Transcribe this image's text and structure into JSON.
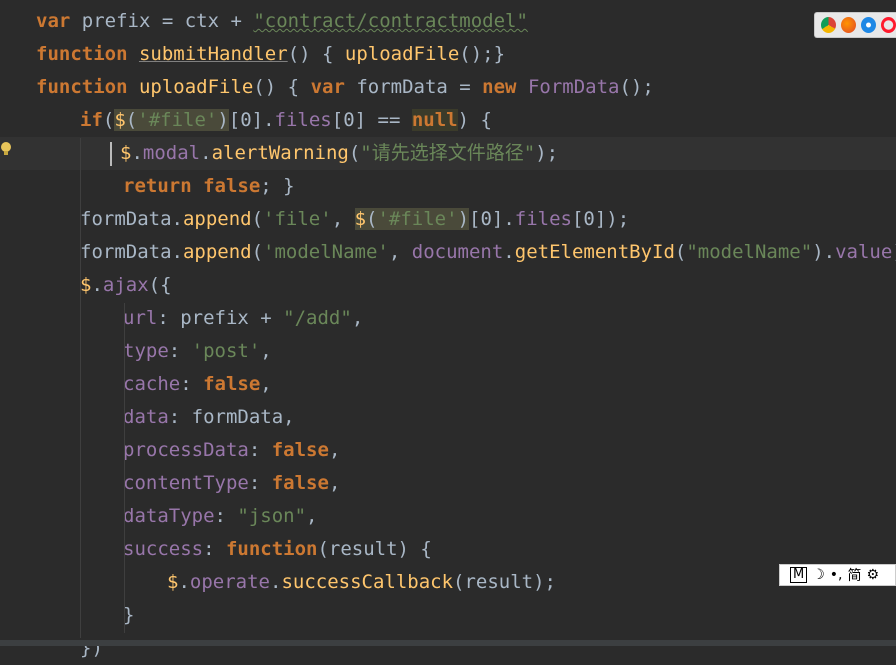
{
  "editor": {
    "lines": [
      {
        "tokens": [
          [
            "kw",
            "var"
          ],
          [
            "pl",
            " prefix = ctx + "
          ],
          [
            "str uw",
            "\"contract/contractmodel\""
          ]
        ]
      },
      {
        "tokens": [
          [
            "kw",
            "function"
          ],
          [
            "pl",
            " "
          ],
          [
            "fn ugray",
            "submitHandler"
          ],
          [
            "pl",
            "() { "
          ],
          [
            "fn",
            "uploadFile"
          ],
          [
            "pl",
            "();}"
          ]
        ]
      },
      {
        "tokens": [
          [
            "kw",
            "function"
          ],
          [
            "pl",
            " "
          ],
          [
            "fn",
            "uploadFile"
          ],
          [
            "pl",
            "() { "
          ],
          [
            "kw",
            "var"
          ],
          [
            "pl",
            " formData = "
          ],
          [
            "kw",
            "new"
          ],
          [
            "pl",
            " "
          ],
          [
            "prop",
            "FormData"
          ],
          [
            "pl",
            "();"
          ]
        ]
      },
      {
        "tokens": [
          [
            "kw",
            "if"
          ],
          [
            "pl",
            "("
          ],
          [
            "fn hl",
            "$"
          ],
          [
            "pl hl",
            "("
          ],
          [
            "str hl",
            "'#file'"
          ],
          [
            "pl hl",
            ")"
          ],
          [
            "pl",
            "[0]."
          ],
          [
            "prop",
            "files"
          ],
          [
            "pl",
            "[0] == "
          ],
          [
            "kw hl2",
            "null"
          ],
          [
            "pl",
            ") {"
          ]
        ]
      },
      {
        "tokens": [
          [
            "fn",
            "$"
          ],
          [
            "pl",
            "."
          ],
          [
            "prop",
            "modal"
          ],
          [
            "pl",
            "."
          ],
          [
            "fn",
            "alertWarning"
          ],
          [
            "pl",
            "("
          ],
          [
            "str",
            "\"请先选择文件路径\""
          ],
          [
            "pl",
            ");"
          ]
        ]
      },
      {
        "tokens": [
          [
            "kw",
            "return false"
          ],
          [
            "pl",
            "; }"
          ]
        ]
      },
      {
        "tokens": [
          [
            "pl",
            "formData."
          ],
          [
            "fn",
            "append"
          ],
          [
            "pl",
            "("
          ],
          [
            "str",
            "'file'"
          ],
          [
            "pl",
            ", "
          ],
          [
            "fn hl",
            "$"
          ],
          [
            "pl hl",
            "("
          ],
          [
            "str hl",
            "'#file'"
          ],
          [
            "pl hl",
            ")"
          ],
          [
            "pl",
            "[0]."
          ],
          [
            "prop",
            "files"
          ],
          [
            "pl",
            "[0]);"
          ]
        ]
      },
      {
        "tokens": [
          [
            "pl",
            "formData."
          ],
          [
            "fn",
            "append"
          ],
          [
            "pl",
            "("
          ],
          [
            "str",
            "'modelName'"
          ],
          [
            "pl",
            ", "
          ],
          [
            "prop",
            "document"
          ],
          [
            "pl",
            "."
          ],
          [
            "fn",
            "getElementById"
          ],
          [
            "pl",
            "("
          ],
          [
            "str",
            "\"modelName\""
          ],
          [
            "pl",
            ")."
          ],
          [
            "prop",
            "value"
          ],
          [
            "pl",
            ");"
          ]
        ]
      },
      {
        "tokens": [
          [
            "fn",
            "$"
          ],
          [
            "pl",
            "."
          ],
          [
            "prop",
            "ajax"
          ],
          [
            "pl",
            "({"
          ]
        ]
      },
      {
        "tokens": [
          [
            "prop",
            "url"
          ],
          [
            "pl",
            ": prefix + "
          ],
          [
            "str",
            "\"/add\""
          ],
          [
            "pl",
            ","
          ]
        ]
      },
      {
        "tokens": [
          [
            "prop",
            "type"
          ],
          [
            "pl",
            ": "
          ],
          [
            "str",
            "'post'"
          ],
          [
            "pl",
            ","
          ]
        ]
      },
      {
        "tokens": [
          [
            "prop",
            "cache"
          ],
          [
            "pl",
            ": "
          ],
          [
            "kw",
            "false"
          ],
          [
            "pl",
            ","
          ]
        ]
      },
      {
        "tokens": [
          [
            "prop",
            "data"
          ],
          [
            "pl",
            ": formData,"
          ]
        ]
      },
      {
        "tokens": [
          [
            "prop",
            "processData"
          ],
          [
            "pl",
            ": "
          ],
          [
            "kw",
            "false"
          ],
          [
            "pl",
            ","
          ]
        ]
      },
      {
        "tokens": [
          [
            "prop",
            "contentType"
          ],
          [
            "pl",
            ": "
          ],
          [
            "kw",
            "false"
          ],
          [
            "pl",
            ","
          ]
        ]
      },
      {
        "tokens": [
          [
            "prop",
            "dataType"
          ],
          [
            "pl",
            ": "
          ],
          [
            "str",
            "\"json\""
          ],
          [
            "pl",
            ","
          ]
        ]
      },
      {
        "tokens": [
          [
            "prop",
            "success"
          ],
          [
            "pl",
            ": "
          ],
          [
            "kw",
            "function"
          ],
          [
            "pl",
            "(result) {"
          ]
        ]
      },
      {
        "tokens": [
          [
            "fn",
            "$"
          ],
          [
            "pl",
            "."
          ],
          [
            "prop",
            "operate"
          ],
          [
            "pl",
            "."
          ],
          [
            "fn",
            "successCallback"
          ],
          [
            "pl",
            "(result);"
          ]
        ]
      },
      {
        "tokens": [
          [
            "pl",
            "}"
          ]
        ]
      },
      {
        "tokens": [
          [
            "pl",
            "})"
          ]
        ]
      }
    ]
  },
  "browser_icons": [
    "chrome-icon",
    "firefox-icon",
    "safari-icon",
    "opera-icon"
  ],
  "ime_toolbar": {
    "mode_label": "M",
    "moon": "☽",
    "punct": "•,",
    "lang": "简",
    "settings": "⚙"
  },
  "colors": {
    "background": "#2b2b2b",
    "keyword": "#cc7832",
    "function": "#ffc66d",
    "string": "#6a8759",
    "property": "#9876aa",
    "plain": "#a9b7c6"
  }
}
